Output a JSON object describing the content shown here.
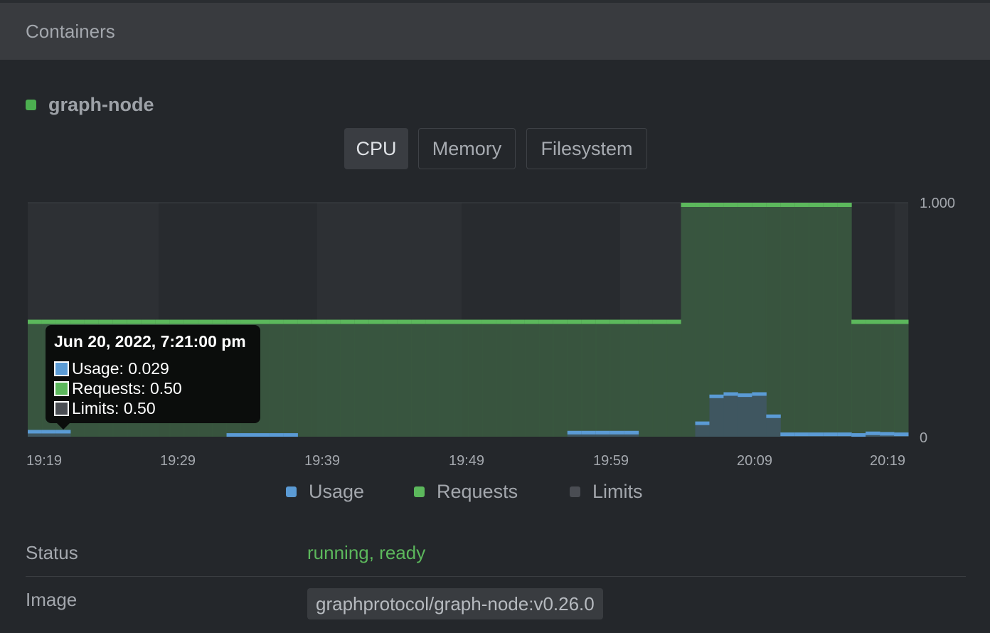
{
  "header": {
    "title": "Containers"
  },
  "container": {
    "name": "graph-node",
    "status_color": "#4caf50"
  },
  "tabs": [
    {
      "label": "CPU",
      "active": true
    },
    {
      "label": "Memory",
      "active": false
    },
    {
      "label": "Filesystem",
      "active": false
    }
  ],
  "tooltip": {
    "title": "Jun 20, 2022, 7:21:00 pm",
    "rows": [
      {
        "label": "Usage: 0.029",
        "color": "#5b9bd5"
      },
      {
        "label": "Requests: 0.50",
        "color": "#5cb85c"
      },
      {
        "label": "Limits: 0.50",
        "color": "#4a4d53"
      }
    ]
  },
  "legend": [
    {
      "label": "Usage",
      "color": "#5b9bd5"
    },
    {
      "label": "Requests",
      "color": "#5cb85c"
    },
    {
      "label": "Limits",
      "color": "#4a4d53"
    }
  ],
  "details": {
    "status_label": "Status",
    "status_value": "running, ready",
    "status_color": "#5cb85c",
    "image_label": "Image",
    "image_value": "graphprotocol/graph-node:v0.26.0"
  },
  "chart_data": {
    "type": "bar",
    "y_ticks": [
      "1.000",
      "0"
    ],
    "ylim": [
      0,
      1
    ],
    "x_tick_labels": [
      "19:19",
      "19:29",
      "19:39",
      "19:49",
      "19:59",
      "20:09",
      "20:19"
    ],
    "series": [
      {
        "name": "Usage",
        "color": "#5b9bd5",
        "values": [
          0.029,
          0.029,
          0.029,
          0,
          0,
          0,
          0,
          0,
          0,
          0,
          0,
          0,
          0,
          0,
          0.015,
          0.015,
          0.015,
          0.015,
          0.015,
          0,
          0,
          0,
          0,
          0,
          0,
          0,
          0,
          0,
          0,
          0,
          0,
          0,
          0,
          0,
          0,
          0,
          0,
          0,
          0.025,
          0.025,
          0.025,
          0.025,
          0.025,
          0,
          0,
          0,
          0,
          0.065,
          0.18,
          0.19,
          0.185,
          0.19,
          0.095,
          0.018,
          0.018,
          0.018,
          0.018,
          0.018,
          0.015,
          0.022,
          0.02,
          0.018
        ]
      },
      {
        "name": "Requests",
        "color": "#5cb85c",
        "values": [
          0.5,
          0.5,
          0.5,
          0.5,
          0.5,
          0.5,
          0.5,
          0.5,
          0.5,
          0.5,
          0.5,
          0.5,
          0.5,
          0.5,
          0.5,
          0.5,
          0.5,
          0.5,
          0.5,
          0.5,
          0.5,
          0.5,
          0.5,
          0.5,
          0.5,
          0.5,
          0.5,
          0.5,
          0.5,
          0.5,
          0.5,
          0.5,
          0.5,
          0.5,
          0.5,
          0.5,
          0.5,
          0.5,
          0.5,
          0.5,
          0.5,
          0.5,
          0.5,
          0.5,
          0.5,
          0.5,
          1.0,
          1.0,
          1.0,
          1.0,
          1.0,
          1.0,
          1.0,
          1.0,
          1.0,
          1.0,
          1.0,
          1.0,
          0.5,
          0.5,
          0.5,
          0.5
        ]
      },
      {
        "name": "Limits",
        "color": "#4a4d53",
        "values": [
          0.5,
          0.5,
          0.5,
          0.5,
          0.5,
          0.5,
          0.5,
          0.5,
          0.5,
          0.5,
          0.5,
          0.5,
          0.5,
          0.5,
          0.5,
          0.5,
          0.5,
          0.5,
          0.5,
          0.5,
          0.5,
          0.5,
          0.5,
          0.5,
          0.5,
          0.5,
          0.5,
          0.5,
          0.5,
          0.5,
          0.5,
          0.5,
          0.5,
          0.5,
          0.5,
          0.5,
          0.5,
          0.5,
          0.5,
          0.5,
          0.5,
          0.5,
          0.5,
          0.5,
          0.5,
          0.5,
          1.0,
          1.0,
          1.0,
          1.0,
          1.0,
          1.0,
          1.0,
          1.0,
          1.0,
          1.0,
          1.0,
          1.0,
          0.5,
          0.5,
          0.5,
          0.5
        ]
      }
    ],
    "grid": true,
    "legend_position": "bottom"
  }
}
